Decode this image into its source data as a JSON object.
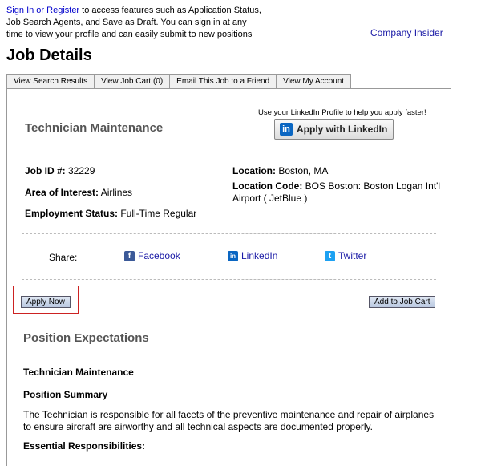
{
  "intro": {
    "link": "Sign In or Register",
    "text": " to access features such as Application Status, Job Search Agents, and Save as Draft. You can sign in at any time to view your profile and can easily submit to new positions"
  },
  "company_insider": "Company Insider",
  "page_title": "Job Details",
  "tabs": [
    {
      "label": "View Search Results"
    },
    {
      "label": "View Job Cart (0)"
    },
    {
      "label": "Email This Job to a Friend"
    },
    {
      "label": "View My Account"
    }
  ],
  "job": {
    "title": "Technician Maintenance",
    "linkedin_prompt": "Use your LinkedIn Profile to help you apply faster!",
    "linkedin_button": "Apply with LinkedIn",
    "linkedin_logo": "in",
    "job_id_label": "Job ID #:",
    "job_id_value": " 32229",
    "area_label": "Area of Interest:",
    "area_value": " Airlines",
    "employment_label": "Employment Status:",
    "employment_value": " Full-Time Regular",
    "location_label": "Location:",
    "location_value": " Boston, MA",
    "location_code_label": "Location Code:",
    "location_code_value": " BOS Boston: Boston Logan Int'l Airport ( JetBlue )"
  },
  "share": {
    "label": "Share:",
    "facebook": "Facebook",
    "linkedin": "LinkedIn",
    "twitter": "Twitter"
  },
  "buttons": {
    "apply_now": "Apply Now",
    "add_to_cart": "Add to Job Cart"
  },
  "position": {
    "section_title": "Position Expectations",
    "subtitle": "Technician  Maintenance",
    "summary_heading": "Position Summary",
    "summary_text": "The Technician is responsible for all facets of the preventive maintenance and repair of airplanes to ensure aircraft are airworthy and all technical aspects are documented properly.",
    "responsibilities_heading": "Essential Responsibilities:"
  },
  "colors": {
    "link": "#0000cc",
    "linkedin_brand": "#0a66c2",
    "facebook_brand": "#3b5998",
    "twitter_brand": "#1da1f2",
    "highlight_box": "#cc2222"
  },
  "icons": [
    "linkedin-icon",
    "facebook-icon",
    "linkedin-share-icon",
    "twitter-icon"
  ]
}
